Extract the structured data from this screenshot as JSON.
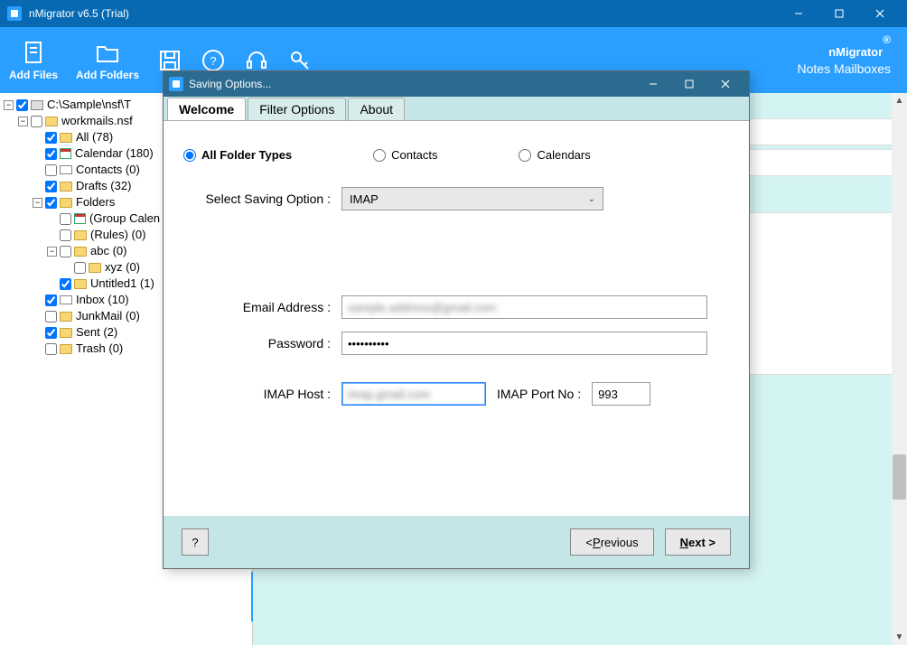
{
  "main": {
    "title": "nMigrator v6.5 (Trial)",
    "brand": {
      "logo": "nMigrator",
      "sub": "Notes Mailboxes"
    }
  },
  "toolbar": {
    "add_files": "Add Files",
    "add_folders": "Add Folders"
  },
  "tree": {
    "root": "C:\\Sample\\nsf\\T",
    "file": "workmails.nsf",
    "items": {
      "all": "All (78)",
      "calendar": "Calendar (180)",
      "contacts": "Contacts (0)",
      "drafts": "Drafts (32)",
      "folders": "Folders",
      "group": "(Group Calen",
      "rules": "(Rules) (0)",
      "abc": "abc (0)",
      "xyz": "xyz (0)",
      "untitled": "Untitled1 (1)",
      "inbox": "Inbox (10)",
      "junk": "JunkMail (0)",
      "sent": "Sent (2)",
      "trash": "Trash (0)"
    }
  },
  "dialog": {
    "title": "Saving Options...",
    "tabs": {
      "welcome": "Welcome",
      "filter": "Filter Options",
      "about": "About"
    },
    "radios": {
      "all": "All Folder Types",
      "contacts": "Contacts",
      "calendars": "Calendars"
    },
    "select_label": "Select Saving Option  :",
    "select_value": "IMAP",
    "email_label": "Email Address  :",
    "email_value": "sample.address@gmail.com",
    "password_label": "Password  :",
    "password_value": "••••••••••",
    "host_label": "IMAP Host  :",
    "host_value": "imap.gmail.com",
    "port_label": "IMAP Port No  :",
    "port_value": "993",
    "help": "?",
    "prev_pre": "<  ",
    "prev_u": "P",
    "prev_post": "revious",
    "next_u": "N",
    "next_post": "ext >"
  }
}
